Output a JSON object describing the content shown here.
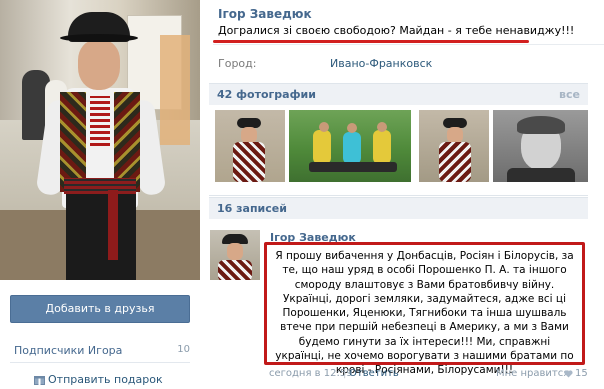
{
  "profile": {
    "name": "Ігор Заведюк",
    "status": "Догралися зі своєю свободою? Майдан - я тебе ненавиджу!!!",
    "city_label": "Город:",
    "city_value": "Ивано-Франковск"
  },
  "sidebar": {
    "add_friend_label": "Добавить в друзья",
    "subscribers_label": "Подписчики Игора",
    "subscribers_count": "10",
    "send_gift_label": "Отправить подарок"
  },
  "photos": {
    "header": "42 фотографии",
    "all_label": "все"
  },
  "wall": {
    "header": "16 записей",
    "post": {
      "author": "Ігор Заведюк",
      "text": "Я прошу вибачення у Донбасців, Росіян і Білорусів, за те, що наш уряд в особі Порошенко П. А. та іншого смороду влаштовує з Вами братовбивчу війну. Українці, дорогі земляки, задумайтеся, адже всі ці Порошенки, Яценюки, Тягнибоки та інша шушваль втече при першій небезпеці в Америку, а ми з Вами будемо гинути за їх інтереси!!! Ми, справжні українці, не хочемо ворогувати з нашими братами по крові - Росіянами, Білорусами!!!",
      "date": "сегодня в 12:59",
      "separator": "|",
      "reply_label": "Ответить",
      "like_label": "Мне нравится",
      "like_count": "15"
    }
  },
  "colors": {
    "link": "#45688e",
    "button": "#5b7fa6",
    "highlight": "#c11919"
  }
}
